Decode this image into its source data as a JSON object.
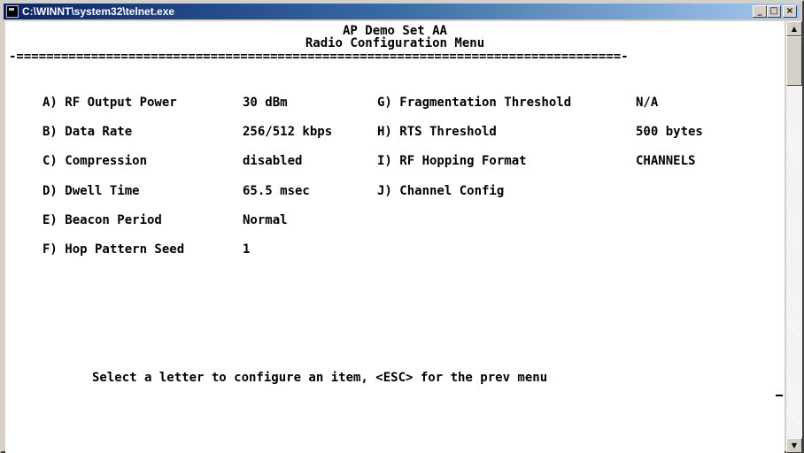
{
  "window": {
    "title": "C:\\WINNT\\system32\\telnet.exe",
    "buttons": {
      "minimize": "_",
      "maximize": "□",
      "close": "×"
    }
  },
  "terminal": {
    "header_line1": "AP Demo Set AA",
    "header_line2": "Radio Configuration Menu",
    "rule": "-=================================================================================-",
    "left_items": [
      {
        "label": "A) RF Output Power",
        "value": "30 dBm"
      },
      {
        "label": "B) Data Rate",
        "value": "256/512 kbps"
      },
      {
        "label": "C) Compression",
        "value": "disabled"
      },
      {
        "label": "D) Dwell Time",
        "value": "65.5 msec"
      },
      {
        "label": "E) Beacon Period",
        "value": "Normal"
      },
      {
        "label": "F) Hop Pattern Seed",
        "value": "1"
      }
    ],
    "right_items": [
      {
        "label": "G) Fragmentation Threshold",
        "value": "N/A"
      },
      {
        "label": "H) RTS Threshold",
        "value": "500 bytes"
      },
      {
        "label": "I) RF Hopping Format",
        "value": "CHANNELS"
      },
      {
        "label": "J) Channel Config",
        "value": ""
      }
    ],
    "prompt": "Select a letter to configure an item, <ESC> for the prev menu"
  },
  "scrollbar": {
    "up_arrow": "▲",
    "down_arrow": "▼"
  }
}
